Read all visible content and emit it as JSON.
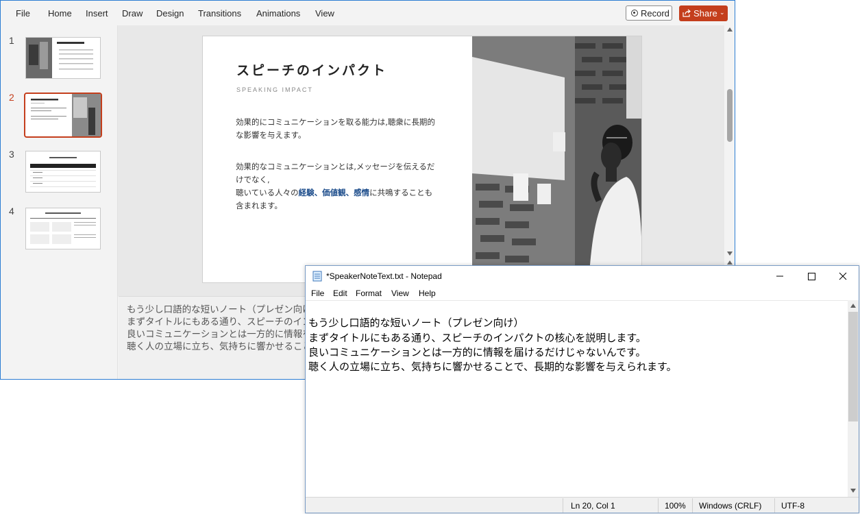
{
  "ribbon": {
    "tabs": [
      "File",
      "Home",
      "Insert",
      "Draw",
      "Design",
      "Transitions",
      "Animations",
      "View"
    ],
    "record_label": "Record",
    "share_label": "Share"
  },
  "thumbnails": {
    "numbers": [
      "1",
      "2",
      "3",
      "4"
    ],
    "active_index": 2
  },
  "slide": {
    "title": "スピーチのインパクト",
    "subtitle": "SPEAKING IMPACT",
    "para1_line1": "効果的にコミュニケーションを取る能力は,聴衆に長期的",
    "para1_line2": "な影響を与えます。",
    "para2_line1": "効果的なコミュニケーションとは,メッセージを伝えるだ",
    "para2_line2": "けでなく,",
    "para2_line3_prefix": "聴いている人々の",
    "para2_kw1": "経験",
    "para2_sep1": "、",
    "para2_kw2": "価値観",
    "para2_sep2": "、",
    "para2_kw3": "感情",
    "para2_line3_suffix": "に共鳴することも",
    "para2_line4": "含まれます。",
    "keyword_color": "#1e4e8c"
  },
  "notes": {
    "lines": [
      "もう少し口語的な短いノート（プレゼン向け）",
      "まずタイトルにもある通り、スピーチのインパクトの核心を説明します。",
      "良いコミュニケーションとは一方的に情報を届けるだけじゃないんです。",
      "聴く人の立場に立ち、気持ちに響かせることで、長期的な影響を与えられます。"
    ]
  },
  "notepad": {
    "title": "*SpeakerNoteText.txt - Notepad",
    "menu": [
      "File",
      "Edit",
      "Format",
      "View",
      "Help"
    ],
    "lines": [
      "もう少し口語的な短いノート（プレゼン向け）",
      "まずタイトルにもある通り、スピーチのインパクトの核心を説明します。",
      "良いコミュニケーションとは一方的に情報を届けるだけじゃないんです。",
      "聴く人の立場に立ち、気持ちに響かせることで、長期的な影響を与えられます。"
    ],
    "status": {
      "position": "Ln 20, Col 1",
      "zoom": "100%",
      "line_ending": "Windows (CRLF)",
      "encoding": "UTF-8"
    }
  },
  "colors": {
    "accent": "#c43e1c",
    "window_border": "#2b7cd3"
  }
}
